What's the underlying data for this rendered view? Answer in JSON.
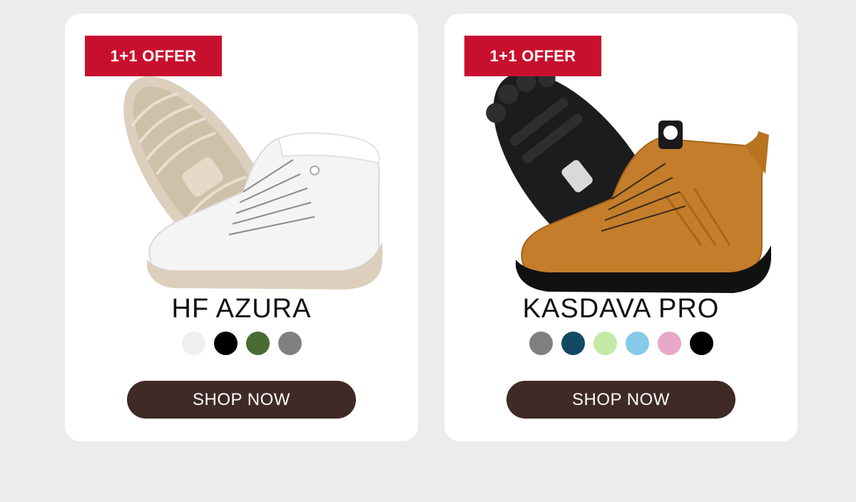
{
  "products": [
    {
      "badge": "1+1 OFFER",
      "name": "HF AZURA",
      "colors": [
        "#f0f0f0",
        "#000000",
        "#4a6b34",
        "#808080"
      ],
      "cta": "SHOP NOW",
      "image_icon": "white-winter-boot-icon"
    },
    {
      "badge": "1+1 OFFER",
      "name": "KASDAVA PRO",
      "colors": [
        "#7f7f7f",
        "#124a63",
        "#c2eaa4",
        "#86c9e8",
        "#e6a8c6",
        "#000000"
      ],
      "cta": "SHOP NOW",
      "image_icon": "tan-winter-boot-icon"
    }
  ],
  "theme": {
    "background": "#ececec",
    "badge_color": "#c8102e",
    "button_color": "#3f2a26"
  }
}
